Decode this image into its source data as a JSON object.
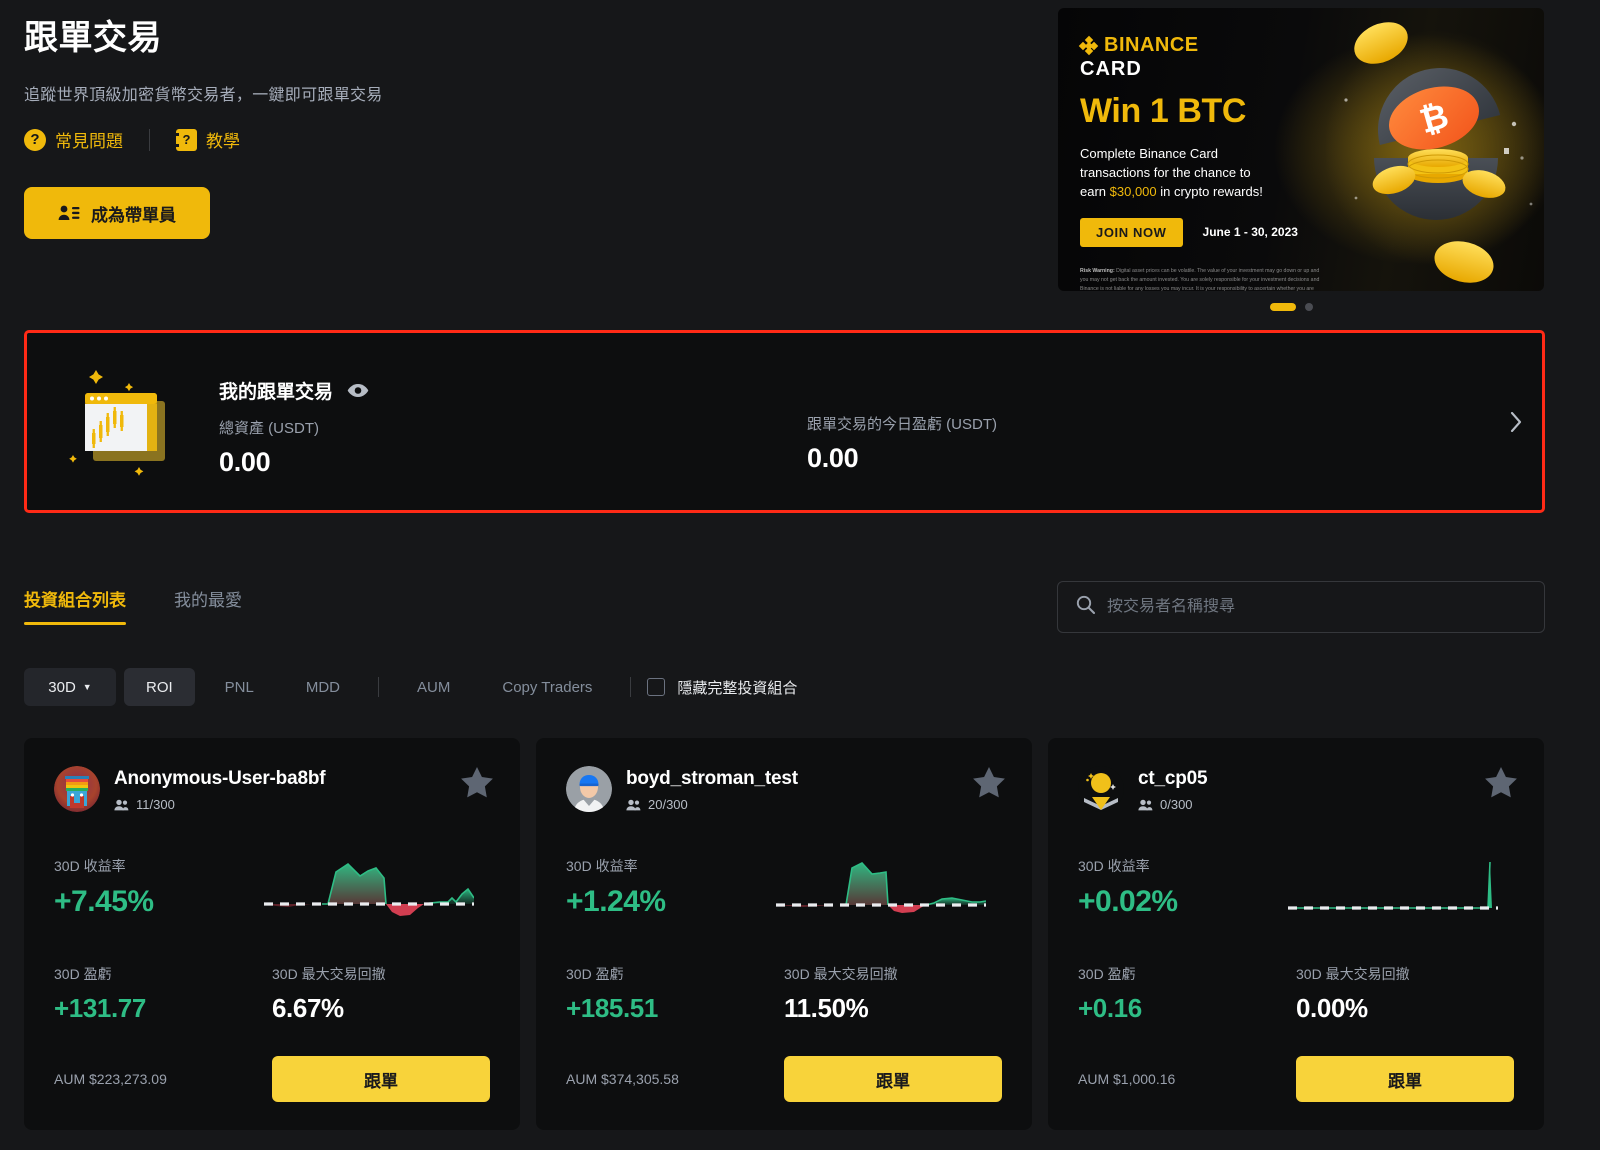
{
  "hero": {
    "title": "跟單交易",
    "subtitle": "追蹤世界頂級加密貨幣交易者，一鍵即可跟單交易",
    "faq_label": "常見問題",
    "faq_icon": "question-mark",
    "tutorial_label": "教學",
    "tutorial_icon": "book",
    "become_lead_label": "成為帶單員"
  },
  "banner": {
    "logo_text": "BINANCE",
    "logo_sub": "CARD",
    "headline": "Win 1 BTC",
    "body_line1": "Complete Binance Card",
    "body_line2": "transactions for the chance to",
    "body_line3_pre": "earn ",
    "body_line3_amount": "$30,000",
    "body_line3_post": " in crypto rewards!",
    "cta_label": "JOIN NOW",
    "date_range": "June 1 - 30, 2023",
    "risk_bold": "Risk Warning:",
    "risk_text": " Digital asset prices can be volatile. The value of your investment may go down or up and you may not get back the amount invested. You are solely responsible for your investment decisions and Binance is not liable for any losses you may incur. It is your responsibility to ascertain whether you are permitted to use the services of Binance based on your individual circumstances. Not financial advice. For more information, see our Terms of Use and Risk Warning."
  },
  "carousel": {
    "slides": 2,
    "active_index": 0
  },
  "my_copy_trading": {
    "title": "我的跟單交易",
    "eye_icon": "eye-icon",
    "total_assets_label": "總資產 (USDT)",
    "total_assets_value": "0.00",
    "today_pnl_label": "跟單交易的今日盈虧 (USDT)",
    "today_pnl_value": "0.00",
    "chevron_icon": "chevron-right-icon",
    "highlight_color": "#FF2A16"
  },
  "tabs": [
    {
      "label": "投資組合列表",
      "active": true
    },
    {
      "label": "我的最愛",
      "active": false
    }
  ],
  "search": {
    "placeholder": "按交易者名稱搜尋",
    "value": "",
    "icon": "search-icon"
  },
  "filters": {
    "period": "30D",
    "period_caret": "▼",
    "metrics": [
      {
        "label": "ROI",
        "active": true
      },
      {
        "label": "PNL",
        "active": false
      },
      {
        "label": "MDD",
        "active": false
      },
      {
        "label": "AUM",
        "active": false
      },
      {
        "label": "Copy Traders",
        "active": false
      }
    ],
    "hide_full_label": "隱藏完整投資組合",
    "hide_full_checked": false
  },
  "card_labels": {
    "roi": "30D 收益率",
    "pnl": "30D 盈虧",
    "mdd": "30D 最大交易回撤",
    "copy_button": "跟單",
    "star_icon": "star-icon",
    "followers_icon": "people-icon"
  },
  "traders": [
    {
      "name": "Anonymous-User-ba8bf",
      "followers": "11/300",
      "roi": "+7.45%",
      "pnl": "+131.77",
      "mdd": "6.67%",
      "aum": "AUM $223,273.09",
      "avatar_type": "pixel-robot",
      "favorited": false
    },
    {
      "name": "boyd_stroman_test",
      "followers": "20/300",
      "roi": "+1.24%",
      "pnl": "+185.51",
      "mdd": "11.50%",
      "aum": "AUM $374,305.58",
      "avatar_type": "grey-person-cap",
      "favorited": false
    },
    {
      "name": "ct_cp05",
      "followers": "0/300",
      "roi": "+0.02%",
      "pnl": "+0.16",
      "mdd": "0.00%",
      "aum": "AUM $1,000.16",
      "avatar_type": "yellow-sun",
      "favorited": false
    }
  ],
  "chart_data": [
    {
      "type": "area",
      "title": "Anonymous-User-ba8bf 30D ROI sparkline",
      "x": [
        0,
        1,
        2,
        3,
        4,
        5,
        6,
        7,
        8,
        9,
        10,
        11,
        12,
        13,
        14,
        15,
        16,
        17,
        18,
        19,
        20,
        21,
        22,
        23,
        24,
        25,
        26,
        27,
        28,
        29
      ],
      "values": [
        0,
        -0.3,
        -0.4,
        -0.2,
        -0.1,
        0,
        0,
        5.2,
        7.6,
        6.4,
        6.9,
        7.3,
        6.0,
        0,
        -1.6,
        -2.4,
        -1.5,
        -0.3,
        0,
        0.5,
        0.9,
        0.8,
        0.7,
        0.6,
        2.4,
        1.1,
        2.6,
        4.6,
        5.4,
        3.1
      ],
      "baseline": 0,
      "positive_color": "#2EBD85",
      "negative_color": "#F6465D",
      "grid": false
    },
    {
      "type": "area",
      "title": "boyd_stroman_test 30D ROI sparkline",
      "x": [
        0,
        1,
        2,
        3,
        4,
        5,
        6,
        7,
        8,
        9,
        10,
        11,
        12,
        13,
        14,
        15,
        16,
        17,
        18,
        19,
        20,
        21,
        22,
        23,
        24,
        25,
        26,
        27,
        28,
        29
      ],
      "values": [
        0,
        -0.2,
        -0.3,
        -0.2,
        -0.1,
        0,
        0,
        6.5,
        8.0,
        6.6,
        6.2,
        6.4,
        6.3,
        0,
        -1.1,
        -1.4,
        -1.2,
        -0.6,
        0,
        0.4,
        0.9,
        1.1,
        0.9,
        0.6,
        0.4,
        0.3,
        0.3,
        0.4,
        0.4,
        0.3
      ],
      "baseline": 0,
      "positive_color": "#2EBD85",
      "negative_color": "#F6465D",
      "grid": false
    },
    {
      "type": "area",
      "title": "ct_cp05 30D ROI sparkline",
      "x": [
        0,
        1,
        2,
        3,
        4,
        5,
        6,
        7,
        8,
        9,
        10,
        11,
        12,
        13,
        14,
        15,
        16,
        17,
        18,
        19,
        20,
        21,
        22,
        23,
        24,
        25,
        26,
        27,
        28,
        29
      ],
      "values": [
        0,
        0,
        0,
        0,
        0,
        0,
        0,
        0,
        0,
        0,
        0,
        0,
        0,
        0,
        0,
        0,
        0,
        0,
        0,
        0,
        0,
        0,
        0,
        0,
        0,
        0,
        0,
        0,
        0,
        9.5
      ],
      "baseline": 0,
      "positive_color": "#2EBD85",
      "negative_color": "#F6465D",
      "grid": false
    }
  ]
}
